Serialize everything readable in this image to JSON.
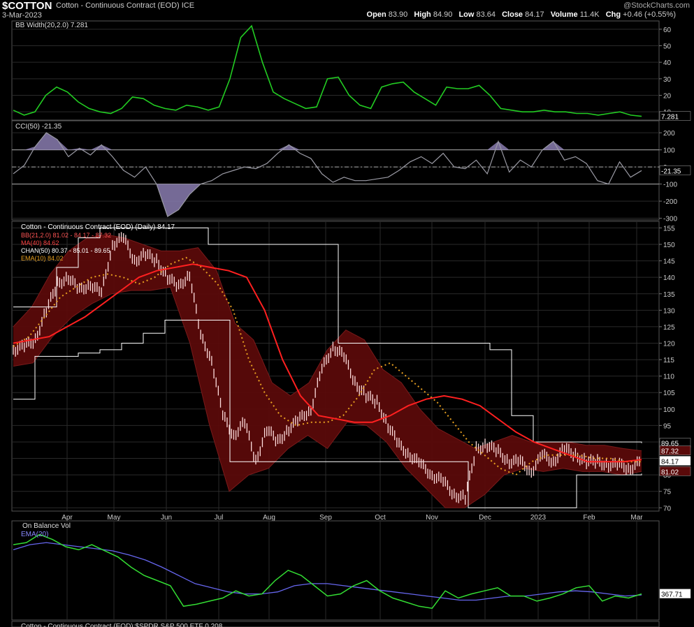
{
  "header": {
    "symbol": "$COTTON",
    "description": "Cotton - Continuous Contract (EOD) ICE",
    "date": "3-Mar-2023",
    "logo": "@StockCharts.com",
    "open_label": "Open",
    "open": "83.90",
    "high_label": "High",
    "high": "84.90",
    "low_label": "Low",
    "low": "83.64",
    "close_label": "Close",
    "close": "84.17",
    "volume_label": "Volume",
    "volume": "11.4K",
    "chg_label": "Chg",
    "chg": "+0.46 (+0.55%)"
  },
  "colors": {
    "background": "#000000",
    "grid": "#2a2a2a",
    "bbwidth": "#22cc22",
    "cci": "#9a9aa4",
    "cci_fill": "#8a7db0",
    "bb_fill": "#5a0a0a",
    "ma": "#ff2020",
    "channel": "#ffffff",
    "ema": "#e8a020",
    "price": "#ffdddd",
    "obv": "#33dd33",
    "obv_ema": "#6666ee"
  },
  "chart_data": [
    {
      "type": "line",
      "panel": "bbwidth",
      "label": "BB Width(20,2.0) 7.281",
      "ylim": [
        5,
        65
      ],
      "yticks": [
        10,
        20,
        30,
        40,
        50,
        60
      ],
      "last_label": "7.281",
      "series": [
        {
          "name": "BB Width(20,2.0)",
          "values": [
            11,
            8,
            10,
            20,
            25,
            22,
            16,
            12,
            10,
            9,
            12,
            19,
            18,
            14,
            12,
            11,
            14,
            13,
            11,
            13,
            30,
            55,
            62,
            40,
            22,
            18,
            15,
            12,
            13,
            30,
            31,
            20,
            14,
            12,
            25,
            27,
            28,
            22,
            18,
            14,
            25,
            24,
            24,
            26,
            20,
            12,
            11,
            10,
            10,
            11,
            10,
            10,
            9,
            9,
            8,
            9,
            10,
            8,
            7.281
          ]
        }
      ]
    },
    {
      "type": "area",
      "panel": "cci",
      "label": "CCI(50) -21.35",
      "ylim": [
        -310,
        270
      ],
      "yticks": [
        -300,
        -200,
        -100,
        0,
        100,
        200
      ],
      "last_label": "-21.35",
      "series": [
        {
          "name": "CCI(50)",
          "values": [
            -40,
            10,
            120,
            200,
            160,
            60,
            110,
            70,
            130,
            60,
            -20,
            -60,
            0,
            -100,
            -290,
            -250,
            -160,
            -100,
            -80,
            -40,
            -20,
            0,
            -10,
            20,
            80,
            130,
            80,
            50,
            -40,
            -90,
            -60,
            -80,
            -80,
            -70,
            -60,
            -20,
            30,
            60,
            20,
            80,
            0,
            -10,
            40,
            -40,
            150,
            -30,
            40,
            0,
            100,
            150,
            40,
            60,
            20,
            -80,
            -100,
            30,
            -60,
            -21.35
          ]
        }
      ]
    },
    {
      "type": "line",
      "panel": "price",
      "title": "Cotton - Continuous Contract (EOD) (Daily) 84.17",
      "ylim": [
        69,
        157
      ],
      "yticks": [
        70,
        75,
        80,
        85,
        90,
        95,
        100,
        105,
        110,
        115,
        120,
        125,
        130,
        135,
        140,
        145,
        150,
        155
      ],
      "xlabels": [
        "Apr",
        "May",
        "Jun",
        "Jul",
        "Aug",
        "Sep",
        "Oct",
        "Nov",
        "Dec",
        "2023",
        "Feb",
        "Mar"
      ],
      "legend": [
        {
          "text": "BB(21,2.0) 81.02 - 84.17 - 87.32"
        },
        {
          "text": "MA(40) 84.62"
        },
        {
          "text": "CHAN(50) 80.37 - 85.01 - 89.65"
        },
        {
          "text": "EMA(10) 84.02"
        }
      ],
      "last_labels": [
        "89.65",
        "87.32",
        "84.17",
        "81.02"
      ],
      "series": [
        {
          "name": "Close",
          "values": [
            118,
            119,
            121,
            130,
            138,
            140,
            136,
            138,
            135,
            150,
            152,
            145,
            147,
            145,
            140,
            137,
            141,
            122,
            115,
            98,
            92,
            96,
            84,
            94,
            90,
            94,
            97,
            100,
            112,
            119,
            116,
            108,
            104,
            102,
            95,
            89,
            86,
            83,
            80,
            78,
            74,
            73,
            88,
            89,
            87,
            84,
            84,
            81,
            86,
            84,
            88,
            86,
            84,
            84,
            83,
            83,
            82,
            84.17
          ]
        },
        {
          "name": "MA(40)",
          "values": [
            120,
            121,
            122,
            125,
            128,
            132,
            136,
            140,
            142,
            143,
            144,
            143,
            142,
            140,
            130,
            115,
            104,
            98,
            97,
            96,
            96,
            98,
            101,
            103,
            104,
            103,
            101,
            97,
            93,
            90,
            88,
            86,
            84,
            84,
            84,
            84.62
          ]
        },
        {
          "name": "EMA(10)",
          "values": [
            119,
            122,
            128,
            134,
            137,
            140,
            141,
            140,
            138,
            140,
            144,
            146,
            143,
            138,
            130,
            115,
            105,
            98,
            95,
            96,
            96,
            98,
            104,
            112,
            114,
            110,
            106,
            102,
            96,
            90,
            86,
            82,
            80,
            84,
            86,
            86,
            86,
            85,
            85,
            84,
            84.02
          ]
        },
        {
          "name": "BB upper",
          "values": [
            125,
            131,
            141,
            148,
            152,
            153,
            152,
            150,
            148,
            148,
            149,
            142,
            126,
            121,
            108,
            104,
            108,
            118,
            124,
            121,
            112,
            108,
            100,
            94,
            91,
            88,
            90,
            92,
            90,
            90,
            90,
            89,
            89,
            88,
            87.32
          ]
        },
        {
          "name": "BB lower",
          "values": [
            113,
            114,
            122,
            128,
            132,
            135,
            136,
            136,
            137,
            120,
            95,
            75,
            80,
            82,
            88,
            92,
            88,
            96,
            95,
            90,
            82,
            76,
            70,
            70,
            74,
            80,
            82,
            81,
            82,
            81,
            81,
            80,
            81.02
          ]
        },
        {
          "name": "CHAN upper",
          "values": [
            131,
            131,
            143,
            152,
            155,
            155,
            155,
            155,
            155,
            150,
            150,
            150,
            150,
            150,
            150,
            120,
            120,
            120,
            120,
            120,
            120,
            120,
            118,
            98,
            90,
            90,
            90,
            90,
            90,
            89.65
          ]
        },
        {
          "name": "CHAN lower",
          "values": [
            103,
            116,
            116,
            117,
            118,
            120,
            123,
            127,
            127,
            127,
            84,
            84,
            84,
            84,
            84,
            84,
            84,
            84,
            84,
            84,
            84,
            70,
            70,
            70,
            70,
            70,
            80,
            80,
            80,
            80.37
          ]
        }
      ]
    },
    {
      "type": "line",
      "panel": "obv",
      "label": "On Balance Vol",
      "last_label": "367.71",
      "series": [
        {
          "name": "On Balance Vol",
          "values": [
            70,
            72,
            80,
            75,
            68,
            65,
            70,
            64,
            58,
            48,
            40,
            35,
            30,
            10,
            12,
            15,
            18,
            25,
            20,
            22,
            35,
            45,
            40,
            30,
            20,
            22,
            30,
            35,
            25,
            18,
            14,
            10,
            8,
            25,
            18,
            22,
            25,
            28,
            20,
            20,
            15,
            18,
            22,
            28,
            30,
            15,
            20,
            18,
            22
          ]
        },
        {
          "name": "EMA(20)",
          "values": [
            65,
            70,
            72,
            70,
            68,
            66,
            64,
            60,
            55,
            48,
            40,
            32,
            28,
            24,
            22,
            22,
            24,
            30,
            32,
            32,
            30,
            28,
            26,
            24,
            22,
            20,
            18,
            16,
            16,
            18,
            20,
            20,
            22,
            24,
            25,
            24,
            22,
            20,
            21
          ]
        }
      ]
    },
    {
      "type": "line",
      "panel": "ratio",
      "label": "Cotton - Continuous Contract (EOD):$SPDR S&P 500 ETF 0.208"
    }
  ]
}
